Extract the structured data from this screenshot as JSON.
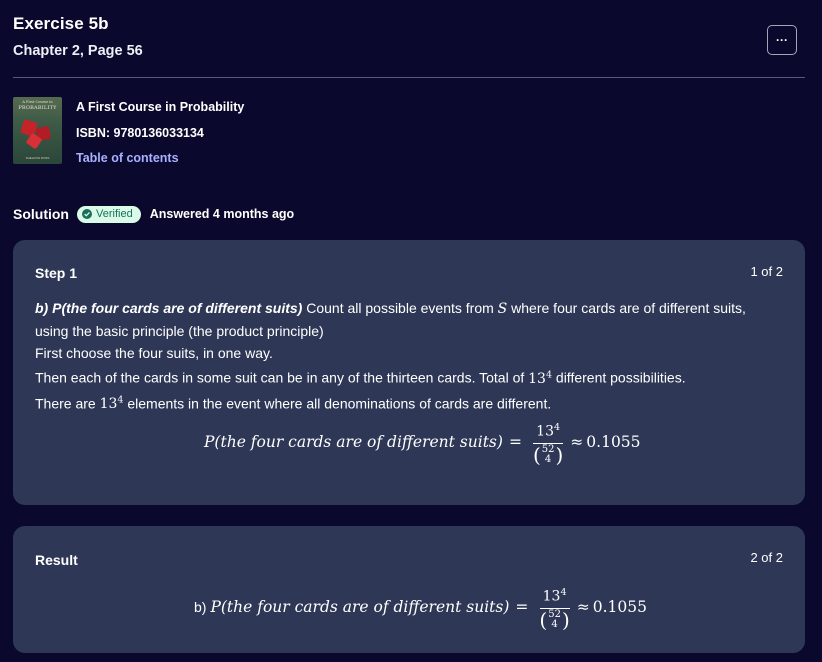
{
  "header": {
    "title": "Exercise 5b",
    "subtitle": "Chapter 2, Page 56",
    "more_label": "···"
  },
  "book": {
    "cover_top": "A First Course in",
    "cover_title": "PROBABILITY",
    "cover_footer": "SHELDON ROSS",
    "title": "A First Course in Probability",
    "isbn": "ISBN: 9780136033134",
    "toc_label": "Table of contents"
  },
  "solution": {
    "label": "Solution",
    "verified_label": "Verified",
    "answered": "Answered 4 months ago"
  },
  "step": {
    "heading": "Step 1",
    "count": "1 of 2",
    "label_b": "b) ",
    "label_italic": "P(the four cards are of different suits)",
    "line1_rest": " Count all possible events from ",
    "line1_S": "S",
    "line1_end": " where four cards are of different suits,",
    "line2": "using the basic principle (the product principle)",
    "line3": "First choose the four suits, in one way.",
    "line4_start": "Then each of the cards in some suit can be in any of the thirteen cards. Total of ",
    "line4_end": " different possibilities.",
    "line5_start": "There are ",
    "line5_end": " elements in the event where all denominations of cards are different.",
    "base": "13",
    "exp": "4"
  },
  "formula": {
    "lhs": "P(the four cards are of different suits)",
    "eq": "=",
    "num_base": "13",
    "num_exp": "4",
    "binom_top": "52",
    "binom_bottom": "4",
    "approx": "≈",
    "value": "0.1055"
  },
  "result": {
    "heading": "Result",
    "count": "2 of 2",
    "prefix": "b)"
  }
}
